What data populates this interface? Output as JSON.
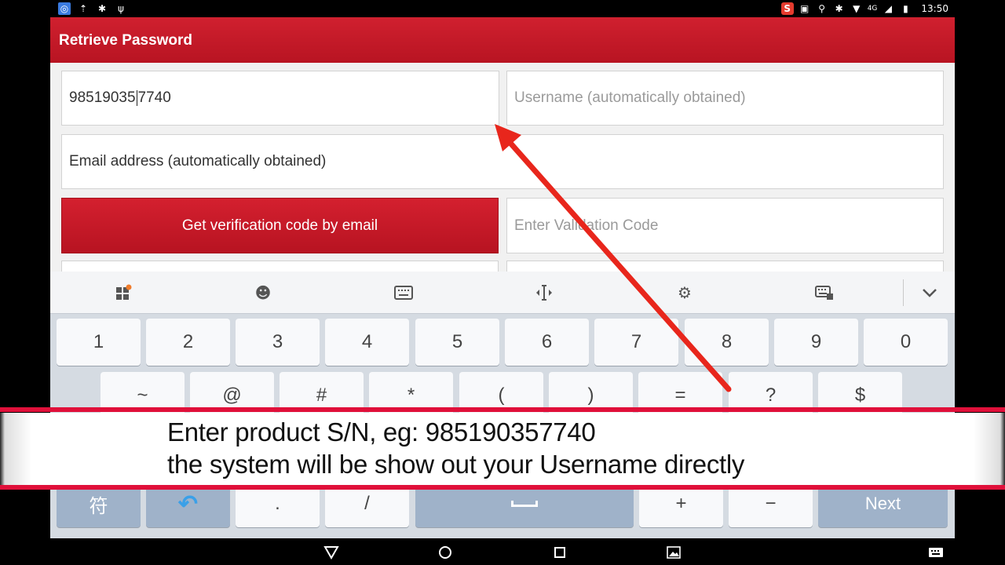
{
  "status_bar": {
    "time": "13:50",
    "network": "4G",
    "left_icons": [
      "app-icon",
      "upload-icon",
      "bluetooth-icon",
      "usb-icon"
    ],
    "right_icons": [
      "sogou-icon",
      "cast-icon",
      "location-icon",
      "bluetooth-icon",
      "wifi-icon",
      "signal-icon",
      "battery-icon"
    ]
  },
  "app_bar": {
    "title": "Retrieve Password"
  },
  "form": {
    "serial_number": {
      "value_before_caret": "98519035",
      "value_after_caret": "7740"
    },
    "username": {
      "placeholder": "Username (automatically obtained)"
    },
    "email": {
      "value": "Email address (automatically obtained)"
    },
    "get_code_button": "Get verification code by email",
    "validation_code": {
      "placeholder": "Enter Validation Code"
    }
  },
  "keyboard": {
    "toolbar_icons": [
      "apps-icon",
      "emoji-icon",
      "keyboard-icon",
      "cursor-icon",
      "settings-icon",
      "keyboard-switch-icon",
      "collapse-icon"
    ],
    "row1": [
      "1",
      "2",
      "3",
      "4",
      "5",
      "6",
      "7",
      "8",
      "9",
      "0"
    ],
    "row2": [
      "~",
      "@",
      "#",
      "*",
      "(",
      ")",
      "=",
      "?",
      "$"
    ],
    "row4": {
      "symbol_key": "符",
      "punct1": ".",
      "punct2": "/",
      "plus": "+",
      "minus": "−",
      "next": "Next"
    }
  },
  "subtitle": {
    "line1": "Enter product S/N, eg: 985190357740",
    "line2": "the system will be show out your Username directly"
  },
  "colors": {
    "brand_red": "#c8192a",
    "arrow_red": "#e8261c",
    "keyboard_bg": "#d5dbe2",
    "key_dark": "#9fb2c9"
  }
}
